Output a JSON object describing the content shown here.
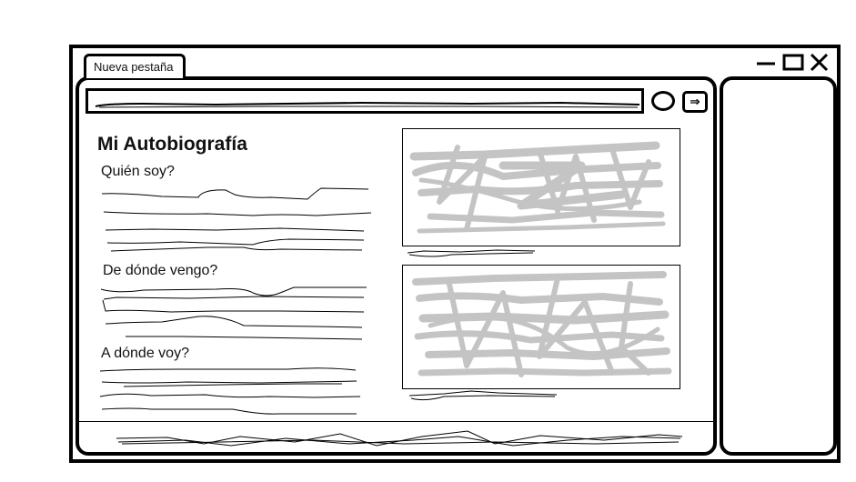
{
  "browser": {
    "tab_label": "Nueva pestaña",
    "forward_glyph": "⇒"
  },
  "page": {
    "title": "Mi Autobiografía",
    "sections": [
      {
        "heading": "Quién soy?"
      },
      {
        "heading": "De dónde vengo?"
      },
      {
        "heading": "A dónde voy?"
      }
    ]
  },
  "icons": {
    "minimize": "minimize-icon",
    "maximize": "maximize-icon",
    "close": "close-icon",
    "go": "circle-button-icon",
    "forward": "arrow-right-icon"
  },
  "colors": {
    "outline": "#000000",
    "scribble_gray": "#c4c4c4"
  }
}
